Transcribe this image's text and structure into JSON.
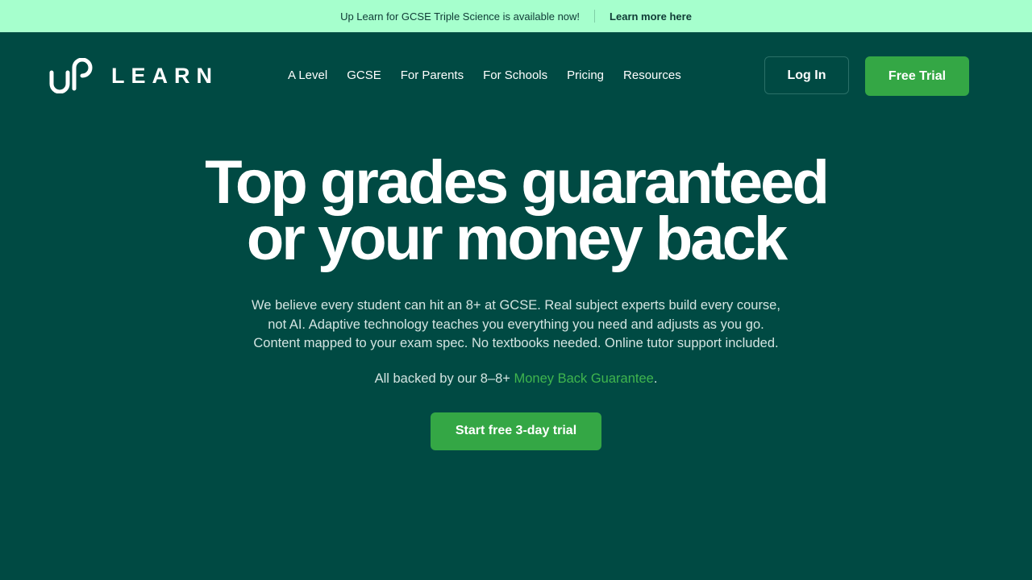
{
  "announcement": {
    "message": "Up Learn for GCSE Triple Science is available now!",
    "link_label": "Learn more here"
  },
  "brand": {
    "wordmark": "LEARN",
    "logo_mark": "UP"
  },
  "nav": {
    "items": [
      {
        "label": "A Level"
      },
      {
        "label": "GCSE"
      },
      {
        "label": "For Parents"
      },
      {
        "label": "For Schools"
      },
      {
        "label": "Pricing"
      },
      {
        "label": "Resources"
      }
    ],
    "login_label": "Log In",
    "trial_label": "Free Trial"
  },
  "hero": {
    "title_line1": "Top grades guaranteed",
    "title_line2": "or your money back",
    "description": "We believe every student can hit an  8+ at GCSE. Real subject experts build every course, not AI. Adaptive technology teaches you everything you need and adjusts as you go. Content mapped to your exam spec. No textbooks needed. Online tutor support included.",
    "backed_prefix": "All backed by our  8–8+ ",
    "guarantee_label": "Money Back Guarantee",
    "backed_suffix": ".",
    "cta_label": "Start free 3-day trial"
  },
  "colors": {
    "background": "#004a43",
    "banner": "#a6ffcd",
    "accent_green": "#34a745",
    "link_green": "#3fb54e"
  }
}
